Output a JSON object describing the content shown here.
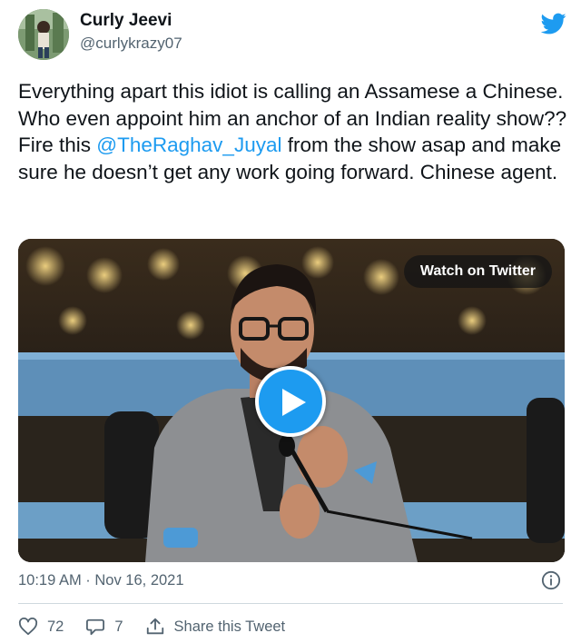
{
  "author": {
    "display_name": "Curly Jeevi",
    "handle": "@curlykrazy07"
  },
  "tweet": {
    "line1": "Everything apart this idiot is calling an Assamese a Chinese. Who even appoint him an anchor of an Indian reality show??",
    "line2_prefix": "Fire this ",
    "mention": "@TheRaghav_Juyal",
    "line2_suffix": " from the show asap and make sure he doesn’t get any work going forward. Chinese agent."
  },
  "video": {
    "watch_label": "Watch on Twitter"
  },
  "footer": {
    "timestamp": "10:19 AM · Nov 16, 2021",
    "likes": "72",
    "replies": "7",
    "share_label": "Share this Tweet"
  },
  "colors": {
    "accent": "#1d9bf0",
    "text": "#0f1419",
    "muted": "#536471"
  },
  "icons": [
    "twitter-bird-icon",
    "play-icon",
    "info-icon",
    "heart-icon",
    "reply-icon",
    "share-icon"
  ]
}
